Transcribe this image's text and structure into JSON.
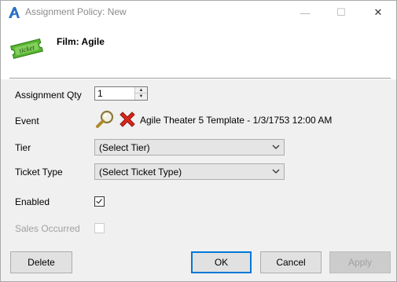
{
  "window": {
    "title": "Assignment Policy: New",
    "minimize_glyph": "—",
    "maximize_glyph": "☐",
    "close_glyph": "✕"
  },
  "header": {
    "film_label": "Film: Agile"
  },
  "form": {
    "assignment_qty": {
      "label": "Assignment Qty",
      "value": "1"
    },
    "event": {
      "label": "Event",
      "value": "Agile Theater 5 Template - 1/3/1753 12:00 AM"
    },
    "tier": {
      "label": "Tier",
      "selected": "(Select Tier)"
    },
    "ticket_type": {
      "label": "Ticket Type",
      "selected": "(Select Ticket Type)"
    },
    "enabled": {
      "label": "Enabled",
      "checked": true
    },
    "sales_occurred": {
      "label": "Sales Occurred",
      "checked": false
    }
  },
  "buttons": {
    "delete": "Delete",
    "ok": "OK",
    "cancel": "Cancel",
    "apply": "Apply"
  },
  "colors": {
    "accent": "#0078d7",
    "delete_red": "#d9261c",
    "ticket_green": "#57b330"
  }
}
